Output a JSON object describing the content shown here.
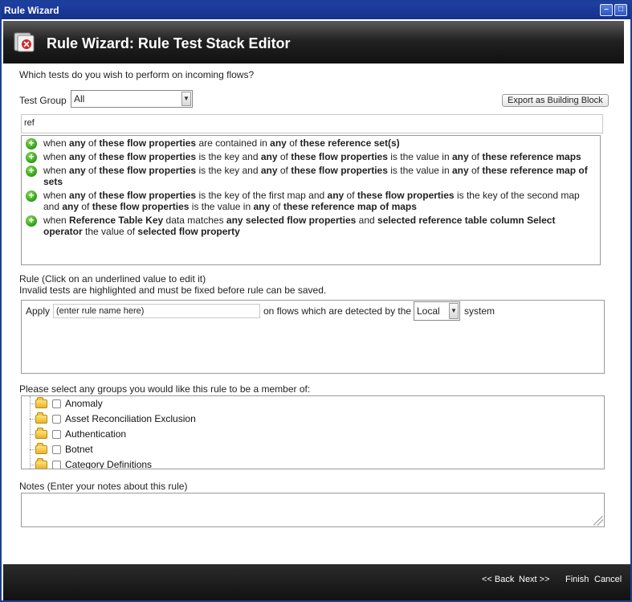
{
  "window": {
    "title": "Rule Wizard"
  },
  "header": {
    "title": "Rule Wizard: Rule Test Stack Editor"
  },
  "question": "Which tests do you wish to perform on incoming flows?",
  "test_group": {
    "label": "Test Group",
    "value": "All"
  },
  "export_button": "Export as Building Block",
  "filter": {
    "value": "ref"
  },
  "tests": [
    {
      "parts": [
        "when ",
        "any",
        " of ",
        "these flow properties",
        " are contained in ",
        "any",
        " of ",
        "these reference set(s)"
      ]
    },
    {
      "parts": [
        "when ",
        "any",
        " of ",
        "these flow properties",
        " is the key and ",
        "any",
        " of ",
        "these flow properties",
        " is the value in ",
        "any",
        " of ",
        "these reference maps"
      ]
    },
    {
      "parts": [
        "when ",
        "any",
        " of ",
        "these flow properties",
        " is the key and ",
        "any",
        " of ",
        "these flow properties",
        " is the value in ",
        "any",
        " of ",
        "these reference map of sets"
      ]
    },
    {
      "parts": [
        "when ",
        "any",
        " of ",
        "these flow properties",
        " is the key of the first map and ",
        "any",
        " of ",
        "these flow properties",
        " is the key of the second map and ",
        "any",
        " of ",
        "these flow properties",
        " is the value in ",
        "any",
        " of ",
        "these reference map of maps"
      ]
    },
    {
      "parts": [
        "when ",
        "Reference Table Key",
        " data matches ",
        "any selected flow properties",
        " and ",
        "selected reference table column Select operator",
        " the value of ",
        "selected flow property"
      ]
    }
  ],
  "rule": {
    "heading": "Rule (Click on an underlined value to edit it)",
    "note": "Invalid tests are highlighted and must be fixed before rule can be saved.",
    "apply_label": "Apply",
    "name_placeholder": "(enter rule name here)",
    "middle_text": "on flows which are detected by the",
    "system_value": "Local",
    "system_label": "system"
  },
  "groups": {
    "heading": "Please select any groups you would like this rule to be a member of:",
    "items": [
      "Anomaly",
      "Asset Reconciliation Exclusion",
      "Authentication",
      "Botnet",
      "Category Definitions"
    ]
  },
  "notes": {
    "heading": "Notes (Enter your notes about this rule)"
  },
  "footer": {
    "back": "<< Back",
    "next": "Next >>",
    "finish": "Finish",
    "cancel": "Cancel"
  }
}
